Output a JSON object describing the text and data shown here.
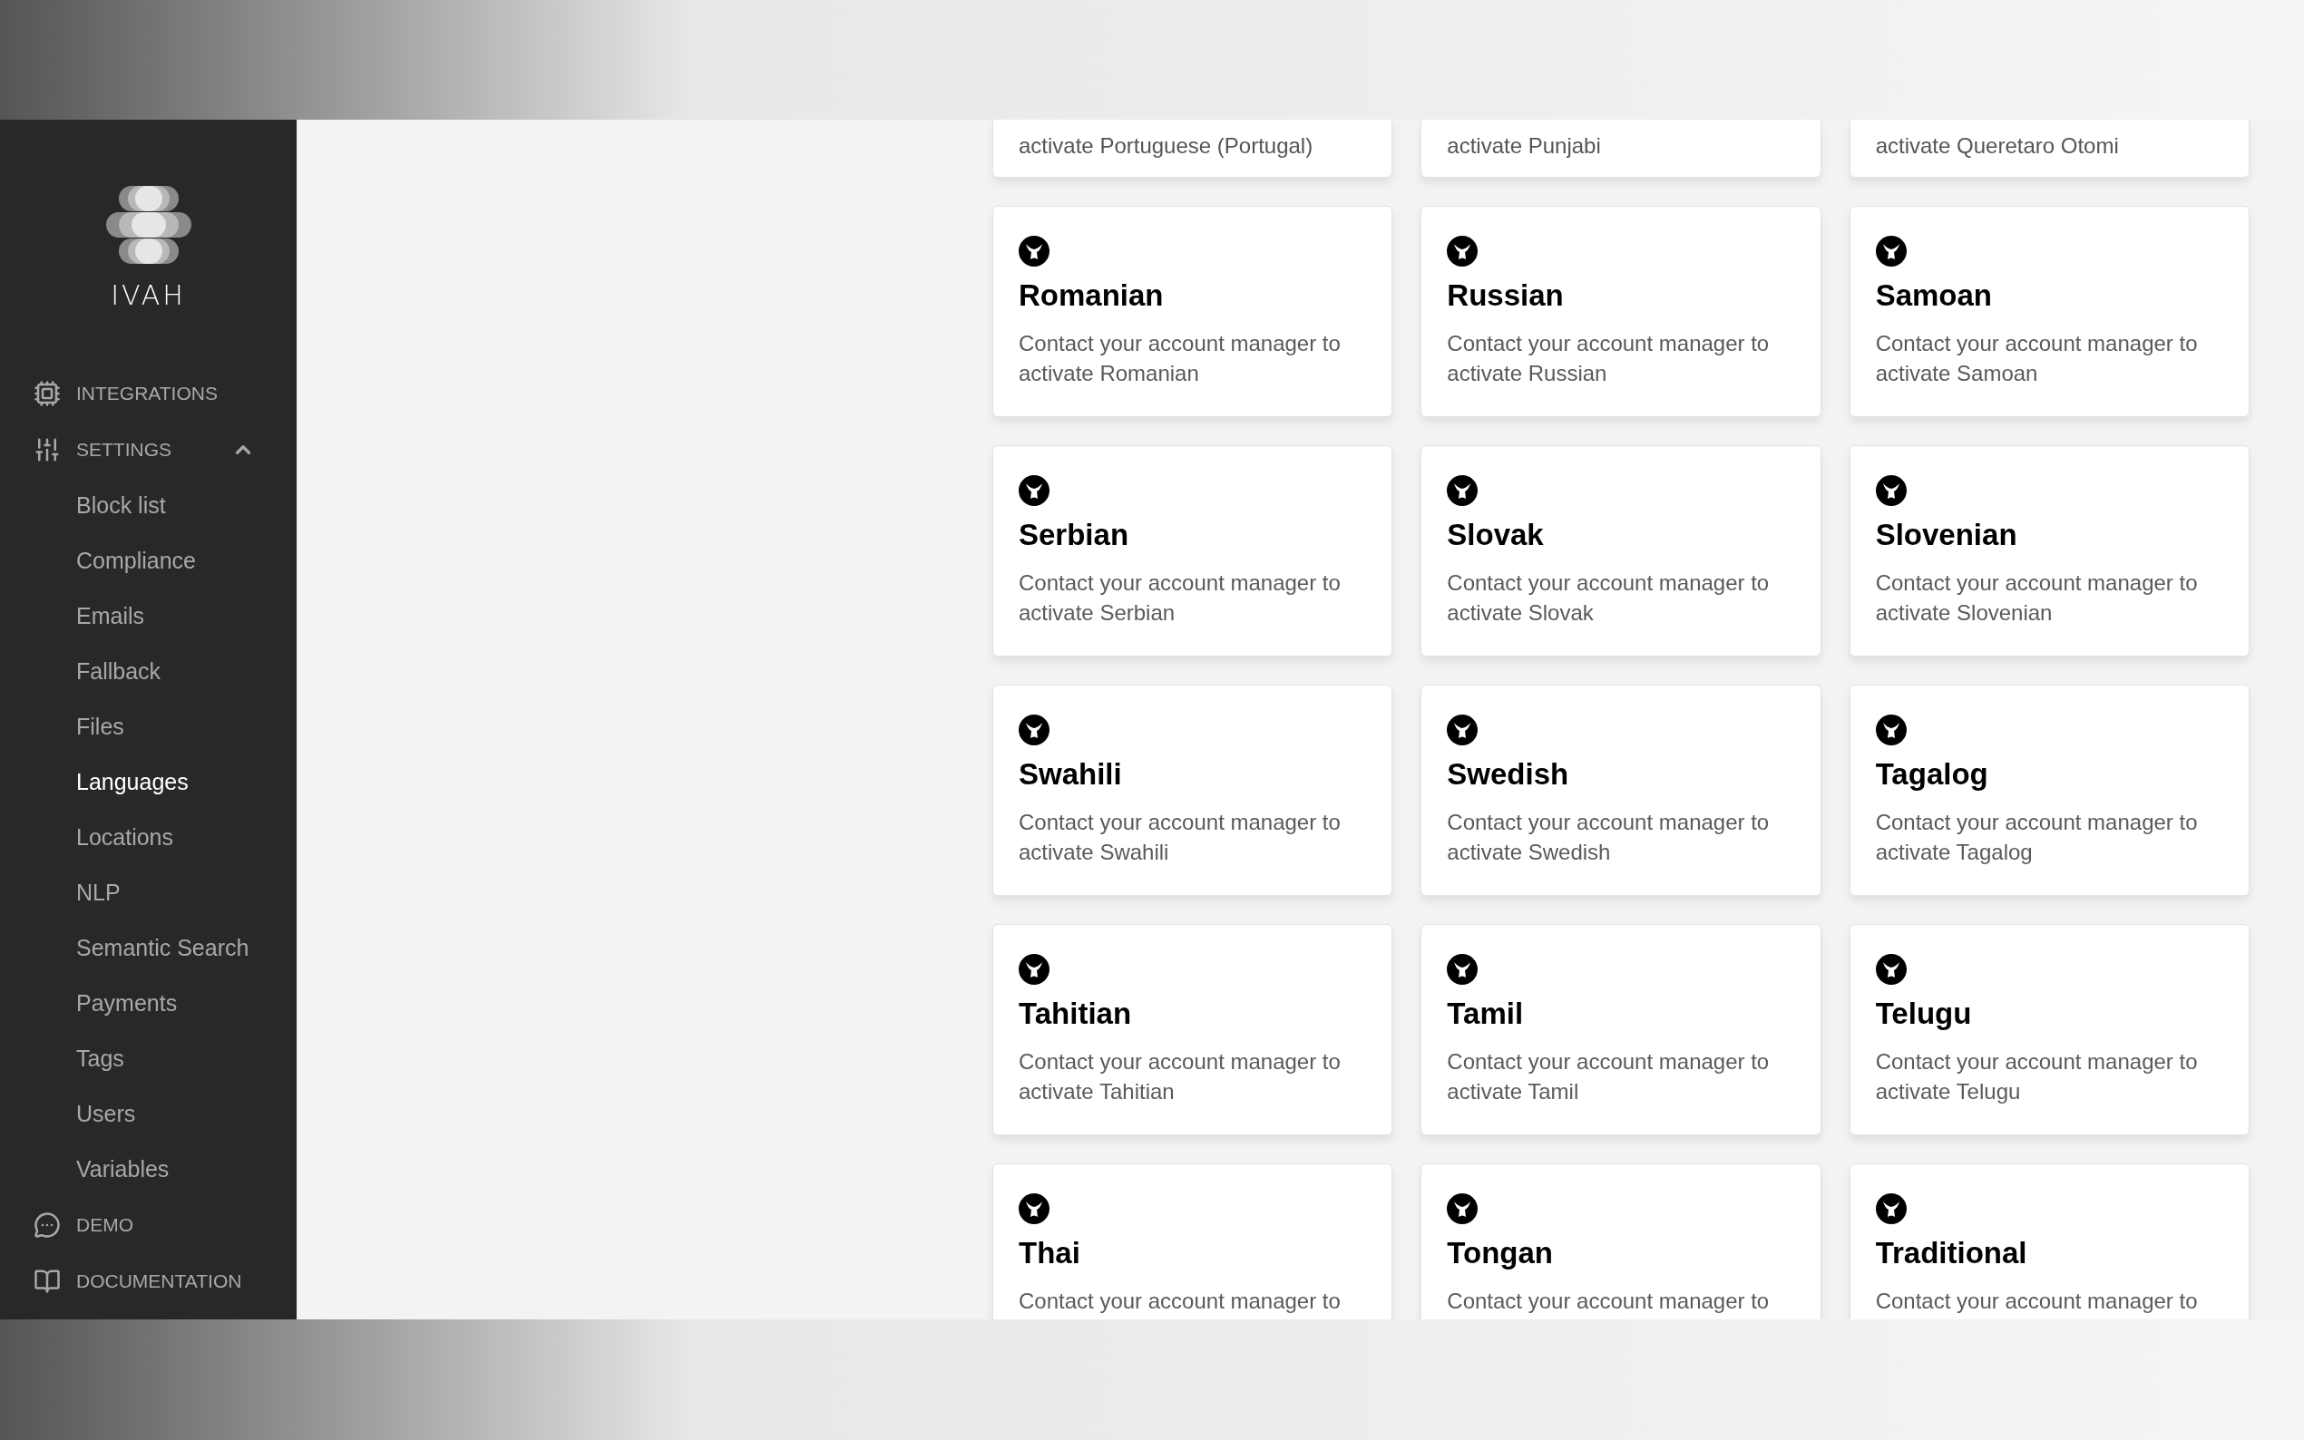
{
  "sidebar": {
    "logo_text": "IVAH",
    "nav": [
      {
        "label": "INTEGRATIONS"
      },
      {
        "label": "SETTINGS",
        "expanded": true,
        "children": [
          {
            "label": "Block list",
            "selected": false
          },
          {
            "label": "Compliance",
            "selected": false
          },
          {
            "label": "Emails",
            "selected": false
          },
          {
            "label": "Fallback",
            "selected": false
          },
          {
            "label": "Files",
            "selected": false
          },
          {
            "label": "Languages",
            "selected": true
          },
          {
            "label": "Locations",
            "selected": false
          },
          {
            "label": "NLP",
            "selected": false
          },
          {
            "label": "Semantic Search",
            "selected": false
          },
          {
            "label": "Payments",
            "selected": false
          },
          {
            "label": "Tags",
            "selected": false
          },
          {
            "label": "Users",
            "selected": false
          },
          {
            "label": "Variables",
            "selected": false
          }
        ]
      },
      {
        "label": "DEMO"
      },
      {
        "label": "DOCUMENTATION"
      }
    ]
  },
  "cards": [
    {
      "kind": "cut_top",
      "description": "activate Portuguese (Portugal)"
    },
    {
      "kind": "cut_top",
      "description": "activate Punjabi"
    },
    {
      "kind": "cut_top",
      "description": "activate Queretaro Otomi"
    },
    {
      "kind": "full",
      "title": "Romanian",
      "description": "Contact your account manager to activate Romanian"
    },
    {
      "kind": "full",
      "title": "Russian",
      "description": "Contact your account manager to activate Russian"
    },
    {
      "kind": "full",
      "title": "Samoan",
      "description": "Contact your account manager to activate Samoan"
    },
    {
      "kind": "full",
      "title": "Serbian",
      "description": "Contact your account manager to activate Serbian"
    },
    {
      "kind": "full",
      "title": "Slovak",
      "description": "Contact your account manager to activate Slovak"
    },
    {
      "kind": "full",
      "title": "Slovenian",
      "description": "Contact your account manager to activate Slovenian"
    },
    {
      "kind": "full",
      "title": "Swahili",
      "description": "Contact your account manager to activate Swahili"
    },
    {
      "kind": "full",
      "title": "Swedish",
      "description": "Contact your account manager to activate Swedish"
    },
    {
      "kind": "full",
      "title": "Tagalog",
      "description": "Contact your account manager to activate Tagalog"
    },
    {
      "kind": "full",
      "title": "Tahitian",
      "description": "Contact your account manager to activate Tahitian"
    },
    {
      "kind": "full",
      "title": "Tamil",
      "description": "Contact your account manager to activate Tamil"
    },
    {
      "kind": "full",
      "title": "Telugu",
      "description": "Contact your account manager to activate Telugu"
    },
    {
      "kind": "cut_bottom",
      "title": "Thai",
      "description": "Contact your account manager to"
    },
    {
      "kind": "cut_bottom",
      "title": "Tongan",
      "description": "Contact your account manager to"
    },
    {
      "kind": "cut_bottom",
      "title": "Traditional",
      "description": "Contact your account manager to"
    }
  ]
}
